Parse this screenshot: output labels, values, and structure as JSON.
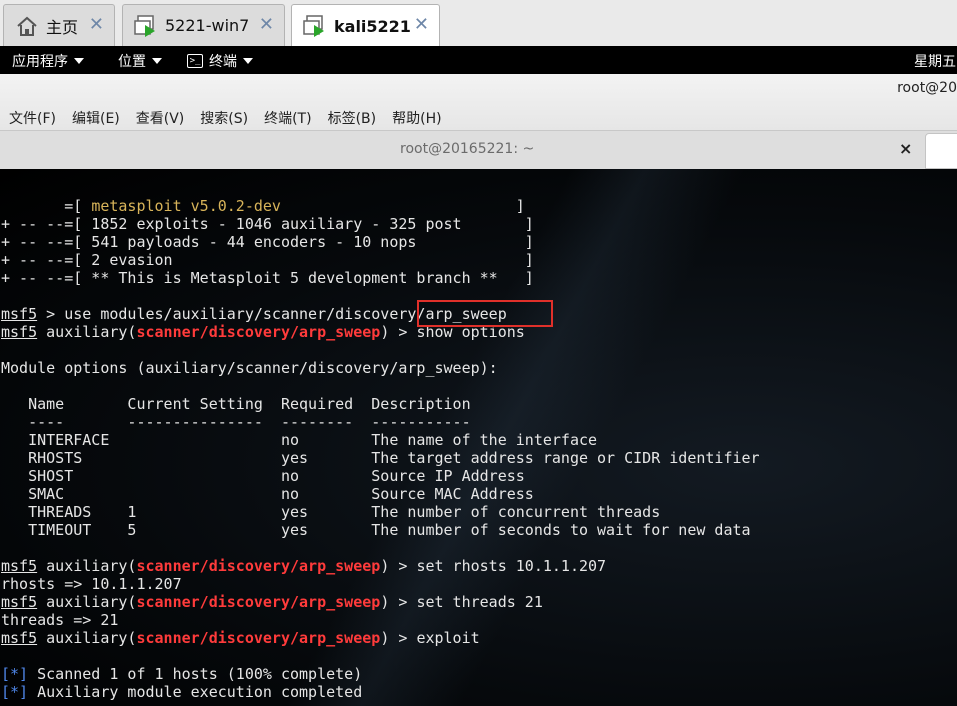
{
  "vm_tabs": [
    {
      "label": "主页",
      "icon": "home-icon"
    },
    {
      "label": "5221-win7",
      "icon": "vm-running-icon"
    },
    {
      "label": "kali5221",
      "icon": "vm-running-icon"
    }
  ],
  "top_panel": {
    "apps_menu": "应用程序",
    "places_menu": "位置",
    "terminal_menu": "终端",
    "clock": "星期五"
  },
  "window": {
    "title_partial": "root@20",
    "menu": [
      "文件(F)",
      "编辑(E)",
      "查看(V)",
      "搜索(S)",
      "终端(T)",
      "标签(B)",
      "帮助(H)"
    ]
  },
  "terminal_tab": {
    "title": "root@20165221: ~",
    "close": "×"
  },
  "terminal": {
    "banner": [
      {
        "pre": "       =[ ",
        "hl": "metasploit v5.0.2-dev",
        "post": "                          ]"
      },
      {
        "pre": "+ -- --=[ 1852 exploits - 1046 auxiliary - 325 post       ]",
        "hl": "",
        "post": ""
      },
      {
        "pre": "+ -- --=[ 541 payloads - 44 encoders - 10 nops            ]",
        "hl": "",
        "post": ""
      },
      {
        "pre": "+ -- --=[ 2 evasion                                       ]",
        "hl": "",
        "post": ""
      },
      {
        "pre": "+ -- --=[ ** This is Metasploit 5 development branch **   ]",
        "hl": "",
        "post": ""
      }
    ],
    "prompt": "msf5",
    "use_cmd": " > use modules/auxiliary/scanner/discovery/arp_sweep",
    "module_prefix": " auxiliary(",
    "module_path": "scanner/discovery/arp_sweep",
    "module_suffix": ") > ",
    "cmd_show": "show options",
    "options_header": "Module options (auxiliary/scanner/discovery/arp_sweep):",
    "table_header": "   Name       Current Setting  Required  Description",
    "table_rule": "   ----       ---------------  --------  -----------",
    "table_rows": [
      "   INTERFACE                   no        The name of the interface",
      "   RHOSTS                      yes       The target address range or CIDR identifier",
      "   SHOST                       no        Source IP Address",
      "   SMAC                        no        Source MAC Address",
      "   THREADS    1                yes       The number of concurrent threads",
      "   TIMEOUT    5                yes       The number of seconds to wait for new data"
    ],
    "cmd_rhosts": "set rhosts 10.1.1.207",
    "out_rhosts": "rhosts => 10.1.1.207",
    "cmd_threads": "set threads 21",
    "out_threads": "threads => 21",
    "cmd_exploit": "exploit",
    "status_marker": "[*]",
    "status_1": " Scanned 1 of 1 hosts (100% complete)",
    "status_2": " Auxiliary module execution completed"
  }
}
